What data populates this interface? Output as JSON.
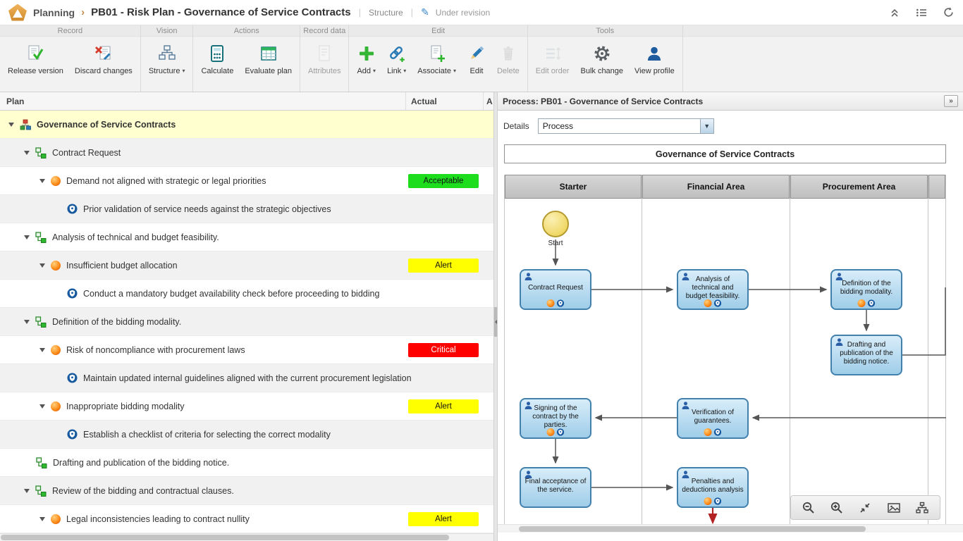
{
  "app": {
    "breadcrumb": "Planning",
    "title": "PB01 - Risk Plan - Governance of Service Contracts",
    "view_label": "Structure",
    "status": "Under revision"
  },
  "toolbar": {
    "groups": [
      {
        "label": "Record",
        "buttons": [
          {
            "label": "Release version"
          },
          {
            "label": "Discard changes"
          }
        ]
      },
      {
        "label": "Vision",
        "buttons": [
          {
            "label": "Structure"
          }
        ]
      },
      {
        "label": "Actions",
        "buttons": [
          {
            "label": "Calculate"
          },
          {
            "label": "Evaluate plan"
          }
        ]
      },
      {
        "label": "Record data",
        "buttons": [
          {
            "label": "Attributes"
          }
        ]
      },
      {
        "label": "Edit",
        "buttons": [
          {
            "label": "Add"
          },
          {
            "label": "Link"
          },
          {
            "label": "Associate"
          },
          {
            "label": "Edit"
          },
          {
            "label": "Delete"
          }
        ]
      },
      {
        "label": "Tools",
        "buttons": [
          {
            "label": "Edit order"
          },
          {
            "label": "Bulk change"
          },
          {
            "label": "View profile"
          }
        ]
      }
    ]
  },
  "tree": {
    "columns": {
      "plan": "Plan",
      "actual": "Actual",
      "a": "A"
    },
    "rows": [
      {
        "level": 0,
        "icon": "plan",
        "label": "Governance of Service Contracts",
        "selected": true
      },
      {
        "level": 1,
        "icon": "activity",
        "label": "Contract Request"
      },
      {
        "level": 2,
        "icon": "risk",
        "label": "Demand not aligned with strategic or legal priorities",
        "badge": "Acceptable",
        "status": "acceptable"
      },
      {
        "level": 3,
        "icon": "control",
        "label": "Prior validation of service needs against the strategic objectives"
      },
      {
        "level": 1,
        "icon": "activity",
        "label": "Analysis of technical and budget feasibility."
      },
      {
        "level": 2,
        "icon": "risk",
        "label": "Insufficient budget allocation",
        "badge": "Alert",
        "status": "alert"
      },
      {
        "level": 3,
        "icon": "control",
        "label": "Conduct a mandatory budget availability check before proceeding to bidding"
      },
      {
        "level": 1,
        "icon": "activity",
        "label": "Definition of the bidding modality."
      },
      {
        "level": 2,
        "icon": "risk",
        "label": "Risk of noncompliance with procurement laws",
        "badge": "Critical",
        "status": "critical"
      },
      {
        "level": 3,
        "icon": "control",
        "label": "Maintain updated internal guidelines aligned with the current procurement legislation"
      },
      {
        "level": 2,
        "icon": "risk",
        "label": "Inappropriate bidding modality",
        "badge": "Alert",
        "status": "alert"
      },
      {
        "level": 3,
        "icon": "control",
        "label": "Establish a checklist of criteria for selecting the correct modality"
      },
      {
        "level": 1,
        "icon": "activity",
        "label": "Drafting and publication of the bidding notice."
      },
      {
        "level": 1,
        "icon": "activity",
        "label": "Review of the bidding and contractual clauses."
      },
      {
        "level": 2,
        "icon": "risk",
        "label": "Legal inconsistencies leading to contract nullity",
        "badge": "Alert",
        "status": "alert"
      }
    ]
  },
  "process": {
    "header": "Process: PB01 - Governance of Service Contracts",
    "expand_glyph": "»",
    "details_label": "Details",
    "details_value": "Process",
    "diagram": {
      "pool_title": "Governance of Service Contracts",
      "lanes": [
        "Starter",
        "Financial Area",
        "Procurement Area"
      ],
      "start_label": "Start",
      "nodes": [
        {
          "label": "Contract Request"
        },
        {
          "label": "Analysis of technical and budget feasibility."
        },
        {
          "label": "Definition of the bidding modality."
        },
        {
          "label": "Drafting and publication of the bidding notice."
        },
        {
          "label": "Signing of the contract by the parties."
        },
        {
          "label": "Verification of guarantees."
        },
        {
          "label": "Final acceptance of the service."
        },
        {
          "label": "Penalties and deductions analysis"
        }
      ]
    }
  },
  "icons": {
    "logo-icon": "orange-pentagon",
    "status-pencil-icon": "✎",
    "collapse-toolbar-icon": "double-chevron-up",
    "list-icon": "bulleted-list",
    "refresh-icon": "circular-arrow",
    "risk-icon": "orange-fireball",
    "control-icon": "blue-shield",
    "activity-icon": "green-flowchart",
    "plan-icon": "org-chart"
  },
  "colors": {
    "acceptable": "#1ddd1d",
    "alert": "#ffff00",
    "critical": "#ff0000"
  }
}
